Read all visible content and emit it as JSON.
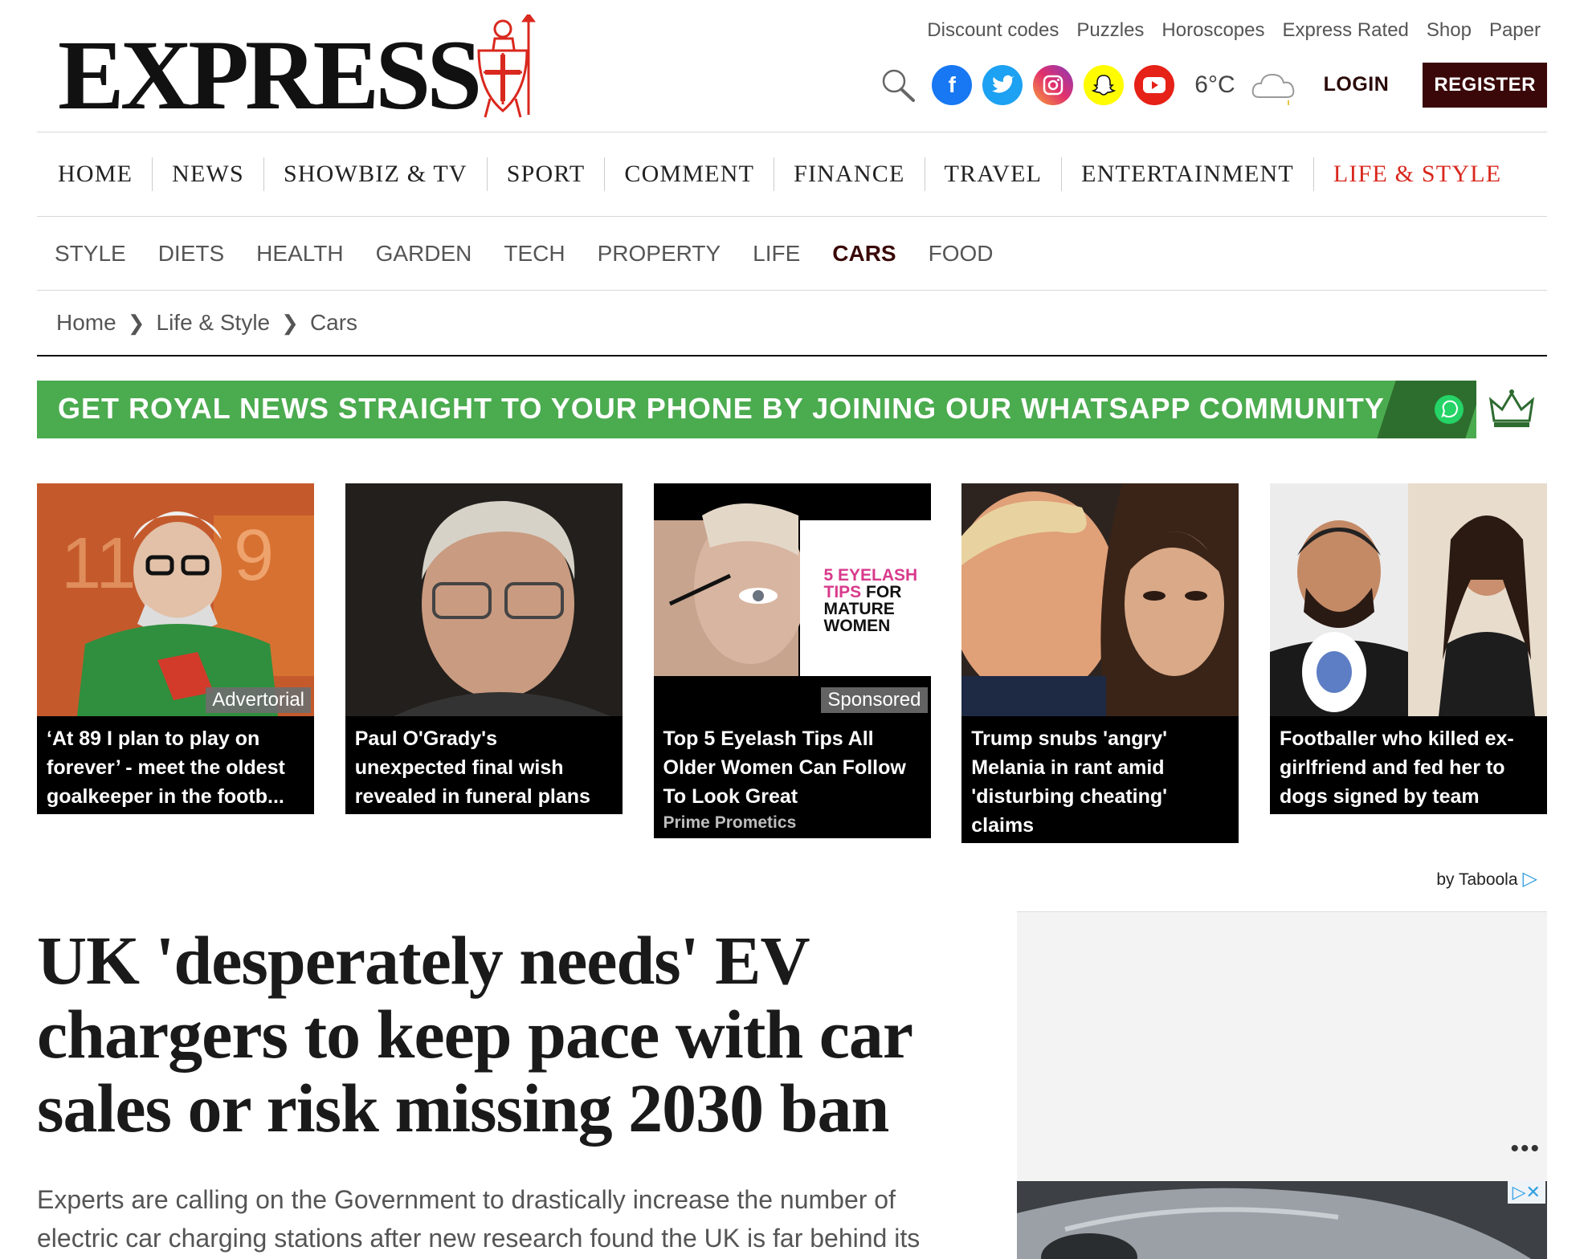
{
  "brand": {
    "logo_text": "EXPRESS"
  },
  "top_links": [
    "Discount codes",
    "Puzzles",
    "Horoscopes",
    "Express Rated",
    "Shop",
    "Paper"
  ],
  "header": {
    "temperature": "6°C",
    "login_label": "LOGIN",
    "register_label": "REGISTER"
  },
  "social_icons": [
    "facebook-icon",
    "twitter-icon",
    "instagram-icon",
    "snapchat-icon",
    "youtube-icon"
  ],
  "colors": {
    "brand_dark": "#3a0808",
    "accent_red": "#d9281e",
    "whatsapp_green": "#4bab4f"
  },
  "main_nav": [
    "HOME",
    "NEWS",
    "SHOWBIZ & TV",
    "SPORT",
    "COMMENT",
    "FINANCE",
    "TRAVEL",
    "ENTERTAINMENT",
    "LIFE & STYLE"
  ],
  "main_nav_active": "LIFE & STYLE",
  "sub_nav": [
    "STYLE",
    "DIETS",
    "HEALTH",
    "GARDEN",
    "TECH",
    "PROPERTY",
    "LIFE",
    "CARS",
    "FOOD"
  ],
  "sub_nav_active": "CARS",
  "breadcrumb": [
    "Home",
    "Life & Style",
    "Cars"
  ],
  "banner": {
    "text": "GET ROYAL NEWS STRAIGHT TO YOUR PHONE BY JOINING OUR WHATSAPP COMMUNITY"
  },
  "cards": [
    {
      "title": "‘At 89 I plan to play on forever’ - meet the oldest goalkeeper in the footb...",
      "tag": "Advertorial",
      "source": ""
    },
    {
      "title": "Paul O'Grady's unexpected final wish revealed in funeral plans",
      "tag": "",
      "source": ""
    },
    {
      "title": "Top 5 Eyelash Tips All Older Women Can Follow To Look Great",
      "tag": "Sponsored",
      "source": "Prime Prometics",
      "image_text": [
        "5 EYELASH",
        "TIPS",
        "FOR",
        "MATURE",
        "WOMEN"
      ]
    },
    {
      "title": "Trump snubs 'angry' Melania in rant amid 'disturbing cheating' claims",
      "tag": "",
      "source": ""
    },
    {
      "title": "Footballer who killed ex-girlfriend and fed her to dogs signed by team",
      "tag": "",
      "source": ""
    }
  ],
  "taboola_label": "by Taboola",
  "article": {
    "headline": "UK 'desperately needs' EV chargers to keep pace with car sales or risk missing 2030 ban",
    "standfirst": "Experts are calling on the Government to drastically increase the number of electric car charging stations after new research found the UK is far behind its"
  },
  "ad": {
    "dots": "•••",
    "choices": "▷✕"
  }
}
